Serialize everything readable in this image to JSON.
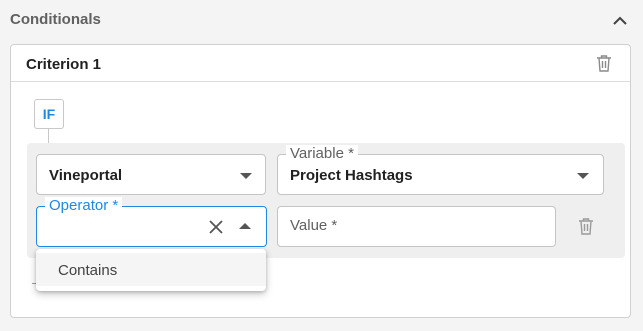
{
  "section": {
    "title": "Conditionals",
    "collapse_icon": "chevron-up-icon"
  },
  "criterion": {
    "title": "Criterion 1",
    "delete_icon": "trash-icon"
  },
  "if_badge": "IF",
  "condition": {
    "source": {
      "value": "Vineportal"
    },
    "variable": {
      "label": "Variable *",
      "value": "Project Hashtags"
    },
    "operator": {
      "label": "Operator *",
      "value": "",
      "state": "focused, open"
    },
    "value_field": {
      "placeholder": "Value *",
      "value": ""
    }
  },
  "dropdown": {
    "options": [
      "Contains"
    ]
  },
  "colors": {
    "accent": "#1e88e5",
    "border": "#c4c4c4",
    "panel_bg": "#efefef",
    "page_bg": "#f4f4f4"
  }
}
